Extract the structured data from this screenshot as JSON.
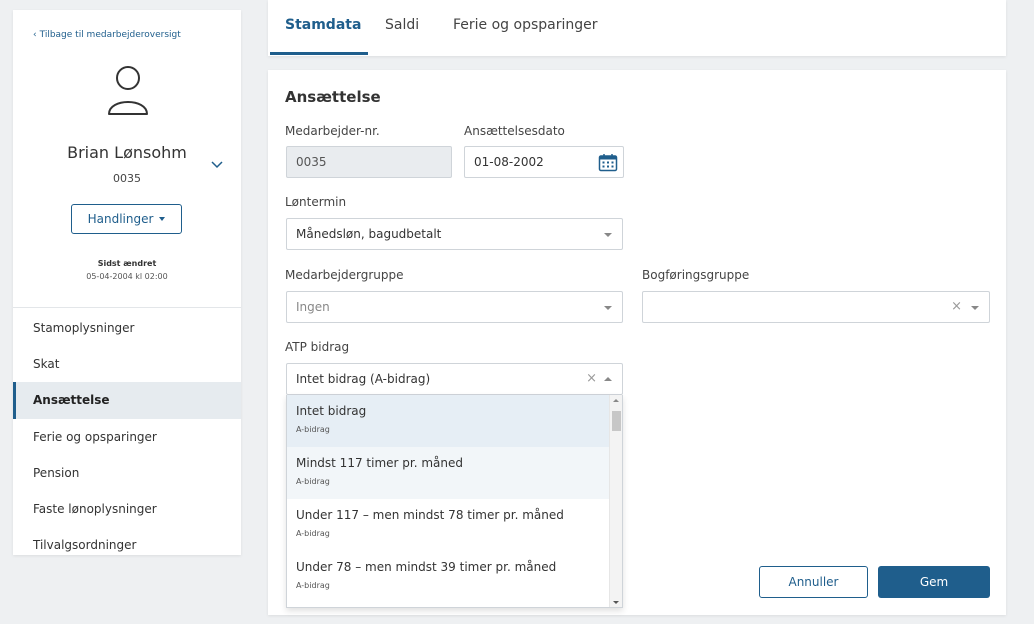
{
  "sidebar": {
    "back_link": "Tilbage til medarbejderoversigt",
    "employee_name": "Brian Lønsohm",
    "employee_number": "0035",
    "actions_label": "Handlinger",
    "last_changed_label": "Sidst ændret",
    "last_changed_value": "05-04-2004 kl 02:00",
    "items": [
      {
        "label": "Stamoplysninger"
      },
      {
        "label": "Skat"
      },
      {
        "label": "Ansættelse"
      },
      {
        "label": "Ferie og opsparinger"
      },
      {
        "label": "Pension"
      },
      {
        "label": "Faste lønoplysninger"
      },
      {
        "label": "Tilvalgsordninger"
      }
    ],
    "active_item": "Ansættelse"
  },
  "tabs": [
    {
      "label": "Stamdata"
    },
    {
      "label": "Saldi"
    },
    {
      "label": "Ferie og opsparinger"
    }
  ],
  "active_tab": "Stamdata",
  "form": {
    "section_title": "Ansættelse",
    "employee_no": {
      "label": "Medarbejder-nr.",
      "value": "0035"
    },
    "hire_date": {
      "label": "Ansættelsesdato",
      "value": "01-08-2002"
    },
    "pay_period": {
      "label": "Løntermin",
      "value": "Månedsløn, bagudbetalt"
    },
    "employee_group": {
      "label": "Medarbejdergruppe",
      "placeholder": "Ingen"
    },
    "accounting_group": {
      "label": "Bogføringsgruppe",
      "value": ""
    },
    "atp": {
      "label": "ATP bidrag",
      "value": "Intet bidrag (A-bidrag)",
      "options": [
        {
          "title": "Intet bidrag",
          "sub": "A-bidrag"
        },
        {
          "title": "Mindst 117 timer pr. måned",
          "sub": "A-bidrag"
        },
        {
          "title": "Under 117 – men mindst 78 timer pr. måned",
          "sub": "A-bidrag"
        },
        {
          "title": "Under 78 – men mindst 39 timer pr. måned",
          "sub": "A-bidrag"
        }
      ]
    }
  },
  "buttons": {
    "cancel": "Annuller",
    "save": "Gem"
  },
  "colors": {
    "primary": "#1f5e8c",
    "background": "#eef0f2",
    "active_nav_bg": "#e6ebef"
  }
}
